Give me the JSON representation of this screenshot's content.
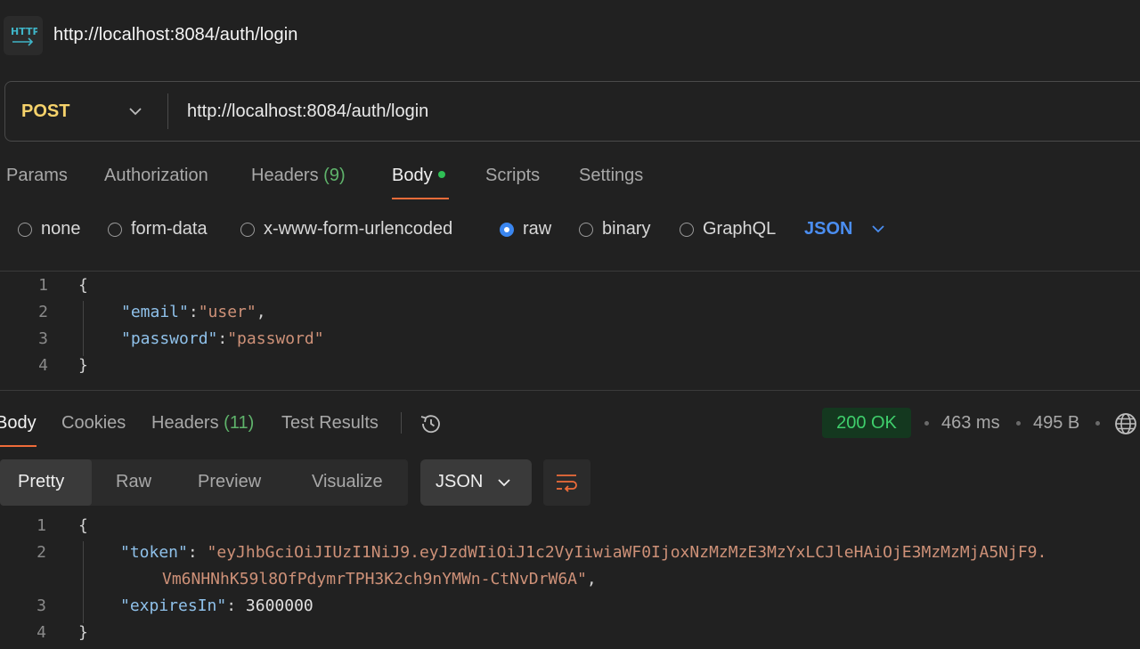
{
  "header": {
    "icon": "http-icon",
    "title": "http://localhost:8084/auth/login"
  },
  "request": {
    "method": "POST",
    "url": "http://localhost:8084/auth/login",
    "tabs": [
      {
        "label": "Params"
      },
      {
        "label": "Authorization"
      },
      {
        "label": "Headers",
        "count": "(9)"
      },
      {
        "label": "Body",
        "active": true,
        "indicator": "green-dot"
      },
      {
        "label": "Scripts"
      },
      {
        "label": "Settings"
      }
    ],
    "body_types": [
      "none",
      "form-data",
      "x-www-form-urlencoded",
      "raw",
      "binary",
      "GraphQL"
    ],
    "selected_body_type": "raw",
    "language": "JSON",
    "code": {
      "line_numbers": [
        "1",
        "2",
        "3",
        "4"
      ],
      "open": "{",
      "email_key": "\"email\"",
      "email_value": "\"user\"",
      "password_key": "\"password\"",
      "password_value": "\"password\"",
      "close": "}"
    }
  },
  "response": {
    "tabs": [
      {
        "label": "Body",
        "active": true
      },
      {
        "label": "Cookies"
      },
      {
        "label": "Headers",
        "count": "(11)"
      },
      {
        "label": "Test Results"
      }
    ],
    "history_icon": "history-icon",
    "status": "200 OK",
    "time": "463 ms",
    "size": "495 B",
    "globe_icon": "globe-icon",
    "views": [
      "Pretty",
      "Raw",
      "Preview",
      "Visualize"
    ],
    "selected_view": "Pretty",
    "format": "JSON",
    "wrap_icon": "wrap-lines-icon",
    "code": {
      "line_numbers": [
        "1",
        "2",
        "3",
        "4"
      ],
      "open": "{",
      "token_key": "\"token\"",
      "token_value_line1": "\"eyJhbGciOiJIUzI1NiJ9.eyJzdWIiOiJ1c2VyIiwiaWF0IjoxNzMzMzE3MzYxLCJleHAiOjE3MzMzMjA5NjF9.",
      "token_value_line2": "Vm6NHNhK59l8OfPdymrTPH3K2ch9nYMWn-CtNvDrW6A\"",
      "expires_key": "\"expiresIn\"",
      "expires_value": "3600000",
      "close": "}"
    }
  },
  "colors": {
    "background": "#212121",
    "method": "#f6d26b",
    "accent_underline": "#ef6c3a",
    "status_ok": "#3fcf6c",
    "json_key": "#8fc1ea",
    "json_string": "#ce9178"
  }
}
